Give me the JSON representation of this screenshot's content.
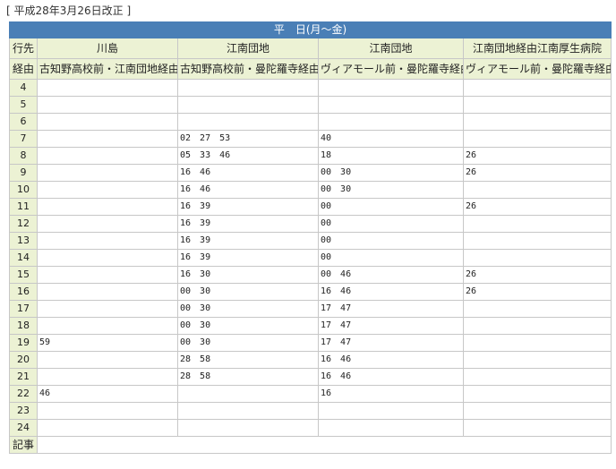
{
  "revision_note": "[ 平成28年3月26日改正 ]",
  "band_title": "平　日(月～金)",
  "header": {
    "dest_label": "行先",
    "via_label": "経由",
    "destinations": [
      "川島",
      "江南団地",
      "江南団地",
      "江南団地経由江南厚生病院"
    ],
    "vias": [
      "古知野高校前・江南団地経由",
      "古知野高校前・曼陀羅寺経由",
      "ヴィアモール前・曼陀羅寺経由",
      "ヴィアモール前・曼陀羅寺経由"
    ]
  },
  "rows": [
    {
      "hour": "4",
      "cells": [
        "",
        "",
        "",
        ""
      ]
    },
    {
      "hour": "5",
      "cells": [
        "",
        "",
        "",
        ""
      ]
    },
    {
      "hour": "6",
      "cells": [
        "",
        "",
        "",
        ""
      ]
    },
    {
      "hour": "7",
      "cells": [
        "",
        "02 27 53",
        "40",
        ""
      ]
    },
    {
      "hour": "8",
      "cells": [
        "",
        "05 33 46",
        "18",
        "26"
      ]
    },
    {
      "hour": "9",
      "cells": [
        "",
        "16 46",
        "00 30",
        "26"
      ]
    },
    {
      "hour": "10",
      "cells": [
        "",
        "16 46",
        "00 30",
        ""
      ]
    },
    {
      "hour": "11",
      "cells": [
        "",
        "16 39",
        "00",
        "26"
      ]
    },
    {
      "hour": "12",
      "cells": [
        "",
        "16 39",
        "00",
        ""
      ]
    },
    {
      "hour": "13",
      "cells": [
        "",
        "16 39",
        "00",
        ""
      ]
    },
    {
      "hour": "14",
      "cells": [
        "",
        "16 39",
        "00",
        ""
      ]
    },
    {
      "hour": "15",
      "cells": [
        "",
        "16 30",
        "00 46",
        "26"
      ]
    },
    {
      "hour": "16",
      "cells": [
        "",
        "00 30",
        "16 46",
        "26"
      ]
    },
    {
      "hour": "17",
      "cells": [
        "",
        "00 30",
        "17 47",
        ""
      ]
    },
    {
      "hour": "18",
      "cells": [
        "",
        "00 30",
        "17 47",
        ""
      ]
    },
    {
      "hour": "19",
      "cells": [
        "59",
        "00 30",
        "17 47",
        ""
      ]
    },
    {
      "hour": "20",
      "cells": [
        "",
        "28 58",
        "16 46",
        ""
      ]
    },
    {
      "hour": "21",
      "cells": [
        "",
        "28 58",
        "16 46",
        ""
      ]
    },
    {
      "hour": "22",
      "cells": [
        "46",
        "",
        "16",
        ""
      ]
    },
    {
      "hour": "23",
      "cells": [
        "",
        "",
        "",
        ""
      ]
    },
    {
      "hour": "24",
      "cells": [
        "",
        "",
        "",
        ""
      ]
    }
  ],
  "notes_label": "記事",
  "notes": ""
}
